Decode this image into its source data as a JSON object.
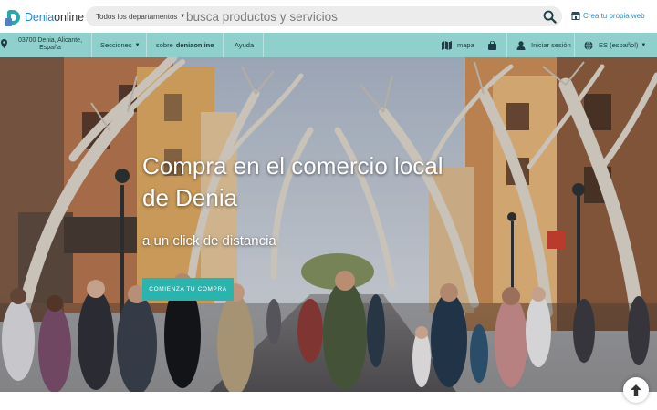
{
  "header": {
    "logo": {
      "brand": "Denia",
      "suffix": "online"
    },
    "search": {
      "department_label": "Todos los departamentos",
      "placeholder": "busca productos y servicios"
    },
    "create_web_label": "Crea tu propia web"
  },
  "navbar": {
    "location_line1": "03700 Denia, Alicante,",
    "location_line2": "España",
    "sections_label": "Secciones",
    "about_prefix": "sobre",
    "about_brand": "deniaonline",
    "help_label": "Ayuda",
    "map_label": "mapa",
    "login_label": "Iniciar sesión",
    "language_label": "ES (español)"
  },
  "hero": {
    "title": "Compra en el comercio local de Denia",
    "subtitle": "a un click de distancia",
    "cta_label": "COMIENZA TU COMPRA"
  },
  "colors": {
    "navbar": "#8fd0cc",
    "accent": "#2bb3ae",
    "brand_blue": "#2d86c6"
  },
  "icons": {
    "search": "search-icon",
    "store": "store-icon",
    "pin": "map-pin-icon",
    "map": "map-icon",
    "bag": "shopping-bag-icon",
    "user": "user-icon",
    "globe": "globe-icon",
    "up": "arrow-up-icon"
  }
}
